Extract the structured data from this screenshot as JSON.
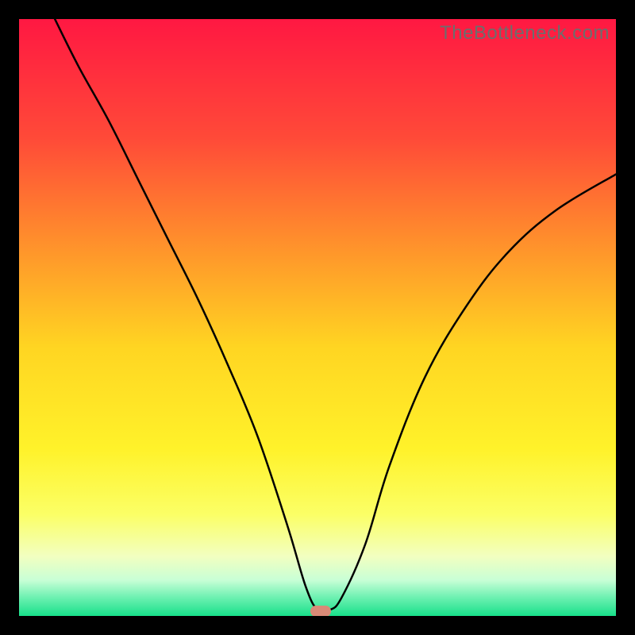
{
  "watermark": "TheBottleneck.com",
  "chart_data": {
    "type": "line",
    "title": "",
    "xlabel": "",
    "ylabel": "",
    "xlim": [
      0,
      100
    ],
    "ylim": [
      0,
      100
    ],
    "grid": false,
    "legend": false,
    "series": [
      {
        "name": "curve",
        "x": [
          6,
          10,
          15,
          20,
          25,
          30,
          35,
          40,
          45,
          48,
          50,
          52,
          54,
          58,
          62,
          68,
          75,
          82,
          90,
          100
        ],
        "y": [
          100,
          92,
          83,
          73,
          63,
          53,
          42,
          30,
          15,
          5,
          1,
          1,
          3,
          12,
          25,
          40,
          52,
          61,
          68,
          74
        ]
      }
    ],
    "marker": {
      "x": 50.5,
      "y": 0.8,
      "color": "#d98a77"
    },
    "background_gradient": {
      "stops": [
        {
          "pos": 0.0,
          "color": "#ff1842"
        },
        {
          "pos": 0.2,
          "color": "#ff4a38"
        },
        {
          "pos": 0.4,
          "color": "#ff9a2a"
        },
        {
          "pos": 0.55,
          "color": "#ffd522"
        },
        {
          "pos": 0.72,
          "color": "#fff22a"
        },
        {
          "pos": 0.83,
          "color": "#fbff66"
        },
        {
          "pos": 0.9,
          "color": "#f2ffc0"
        },
        {
          "pos": 0.94,
          "color": "#c8ffd6"
        },
        {
          "pos": 0.97,
          "color": "#6af0b0"
        },
        {
          "pos": 1.0,
          "color": "#18e08a"
        }
      ]
    }
  }
}
